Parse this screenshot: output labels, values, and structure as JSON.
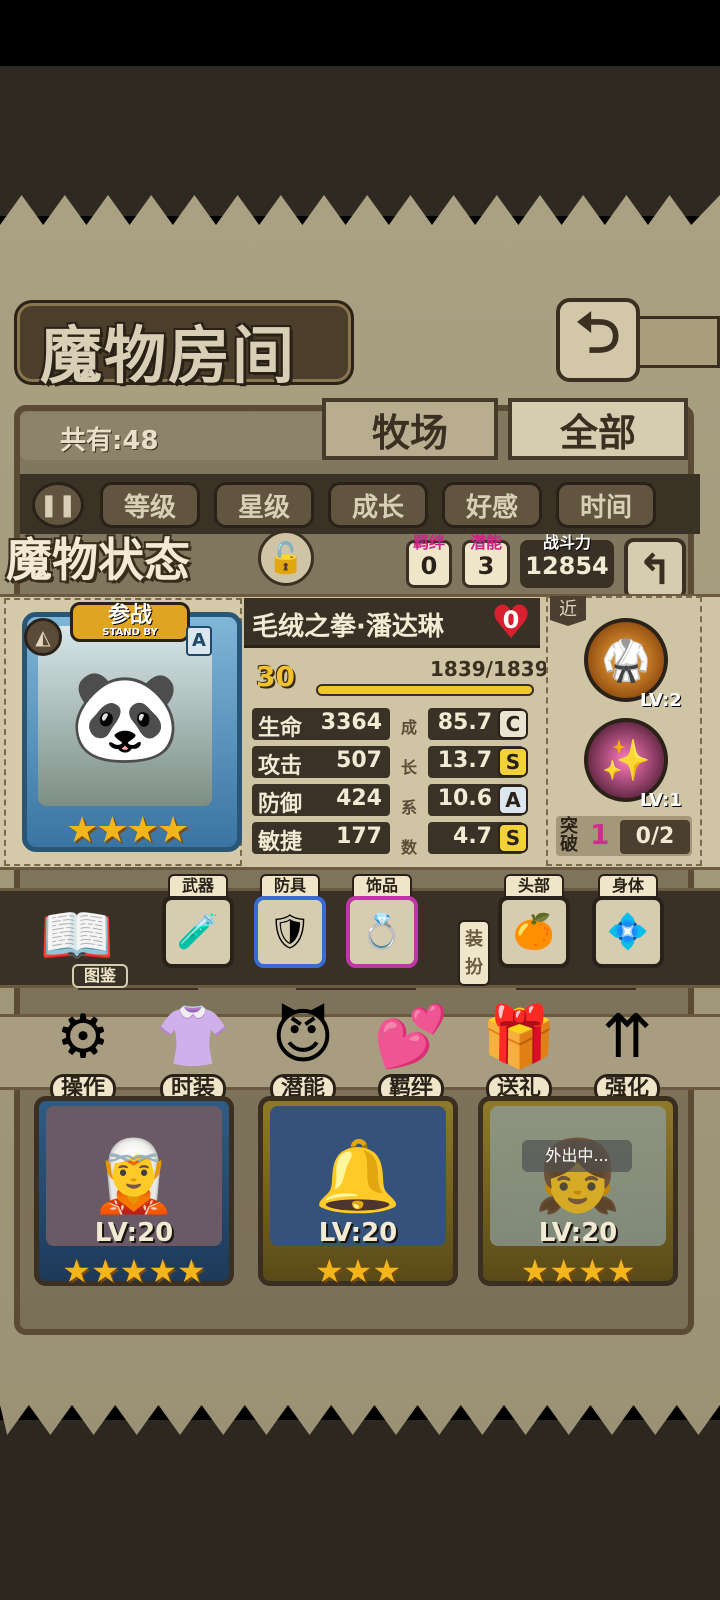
{
  "header": {
    "title": "魔物房间",
    "back_icon": "return-arrow-icon"
  },
  "filter": {
    "count_label": "共有:48",
    "tabs": [
      "牧场",
      "全部"
    ],
    "sort_buttons": [
      "等级",
      "星级",
      "成长",
      "好感",
      "时间"
    ],
    "pause_icon": "pause-icon"
  },
  "status": {
    "title": "魔物状态",
    "lock_icon": "lock-icon",
    "bond": {
      "label": "羁绊",
      "value": "0"
    },
    "potential": {
      "label": "潜能",
      "value": "3"
    },
    "power": {
      "label": "战斗力",
      "value": "12854"
    },
    "monster": {
      "name": "毛绒之拳·潘达琳",
      "affection": "0",
      "standby": {
        "label": "参战",
        "sub": "STAND BY"
      },
      "rank": "A",
      "stars": "★★★★",
      "star_count": 4,
      "level": "30",
      "exp_text": "1839/1839",
      "exp_fraction": 1.0
    },
    "stats": [
      {
        "label": "生命",
        "value": "3364",
        "growth": "85.7",
        "grade": "C"
      },
      {
        "label": "攻击",
        "value": "507",
        "growth": "13.7",
        "grade": "S"
      },
      {
        "label": "防御",
        "value": "424",
        "growth": "10.6",
        "grade": "A"
      },
      {
        "label": "敏捷",
        "value": "177",
        "growth": "4.7",
        "grade": "S"
      }
    ],
    "growth_label": [
      "成",
      "长",
      "系",
      "数"
    ],
    "range_tag": "近",
    "skills": [
      {
        "level": "LV:2"
      },
      {
        "level": "LV:1"
      }
    ],
    "break": {
      "label": "突破",
      "count": "1",
      "progress": "0/2"
    }
  },
  "equipment": {
    "codex_label": "图鉴",
    "slots": [
      "武器",
      "防具",
      "饰品"
    ],
    "dress_label": "装扮",
    "costume_slots": [
      "头部",
      "身体"
    ]
  },
  "actions": [
    "操作",
    "时装",
    "潜能",
    "羁绊",
    "送礼",
    "强化"
  ],
  "list_cards": [
    {
      "level": "LV:20",
      "stars": "★★★★★"
    },
    {
      "level": "LV:20",
      "stars": "★★★"
    },
    {
      "level": "LV:20",
      "stars": "★★★★",
      "away": "外出中..."
    }
  ],
  "colors": {
    "grade_C": "#e9e3d2",
    "grade_S": "#f3d13a",
    "grade_A": "#dce6ee",
    "accent_pink": "#d0208a"
  }
}
